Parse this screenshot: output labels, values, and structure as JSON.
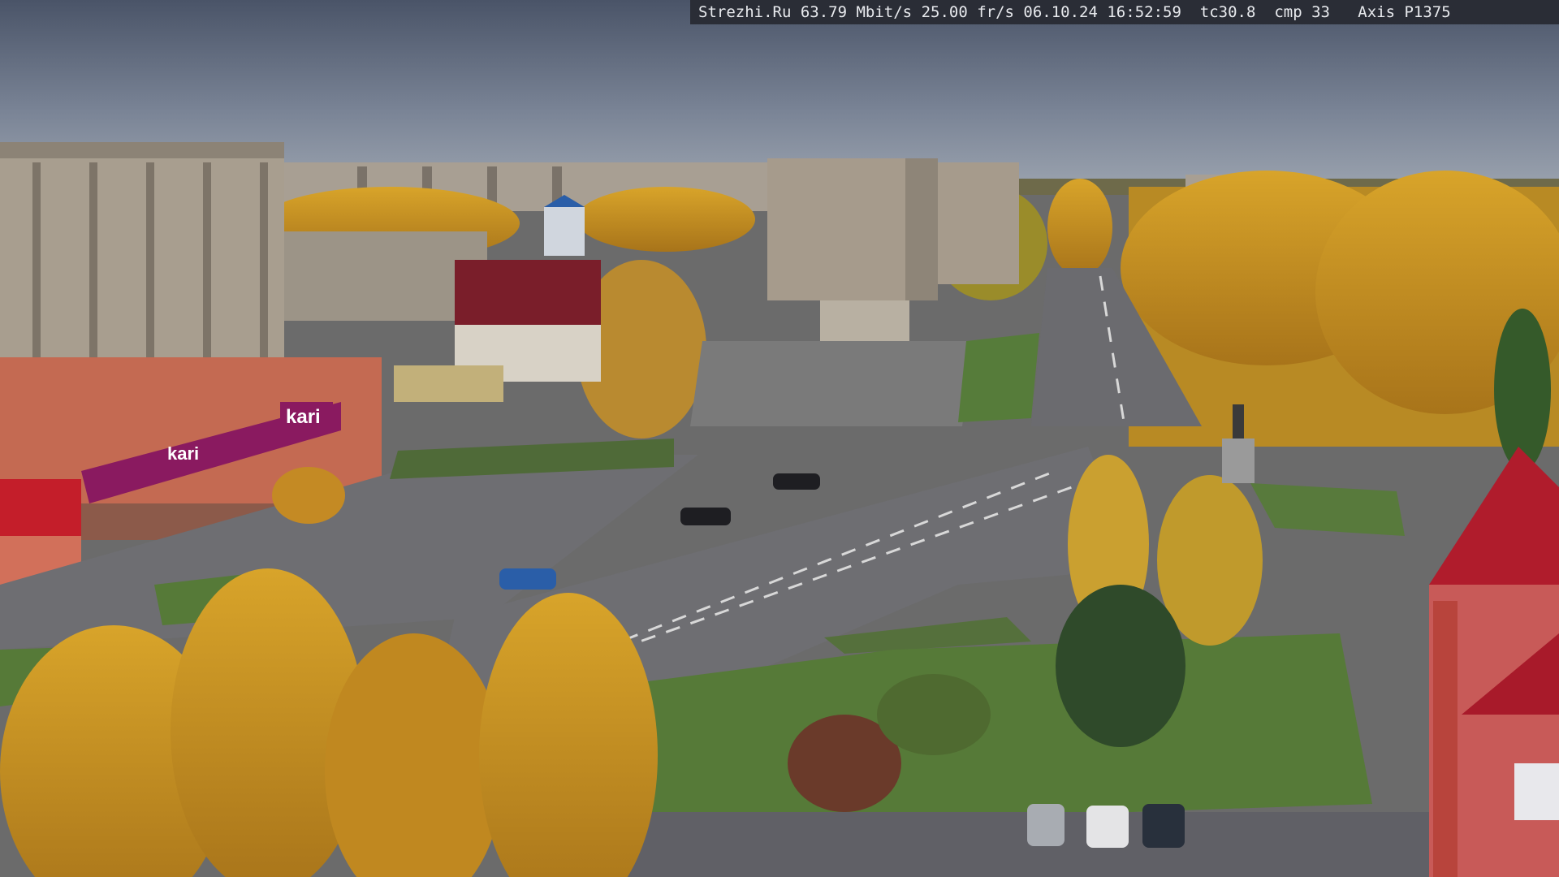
{
  "overlay": {
    "site": "Strezhi.Ru",
    "bitrate": "63.79 Mbit/s",
    "framerate": "25.00 fr/s",
    "datetime": "06.10.24 16:52:59",
    "tc": "tc30.8",
    "cmp": "cmp 33",
    "camera": "Axis P1375"
  },
  "signs": {
    "store_kari": "kari",
    "store_kari_side": "kari"
  }
}
